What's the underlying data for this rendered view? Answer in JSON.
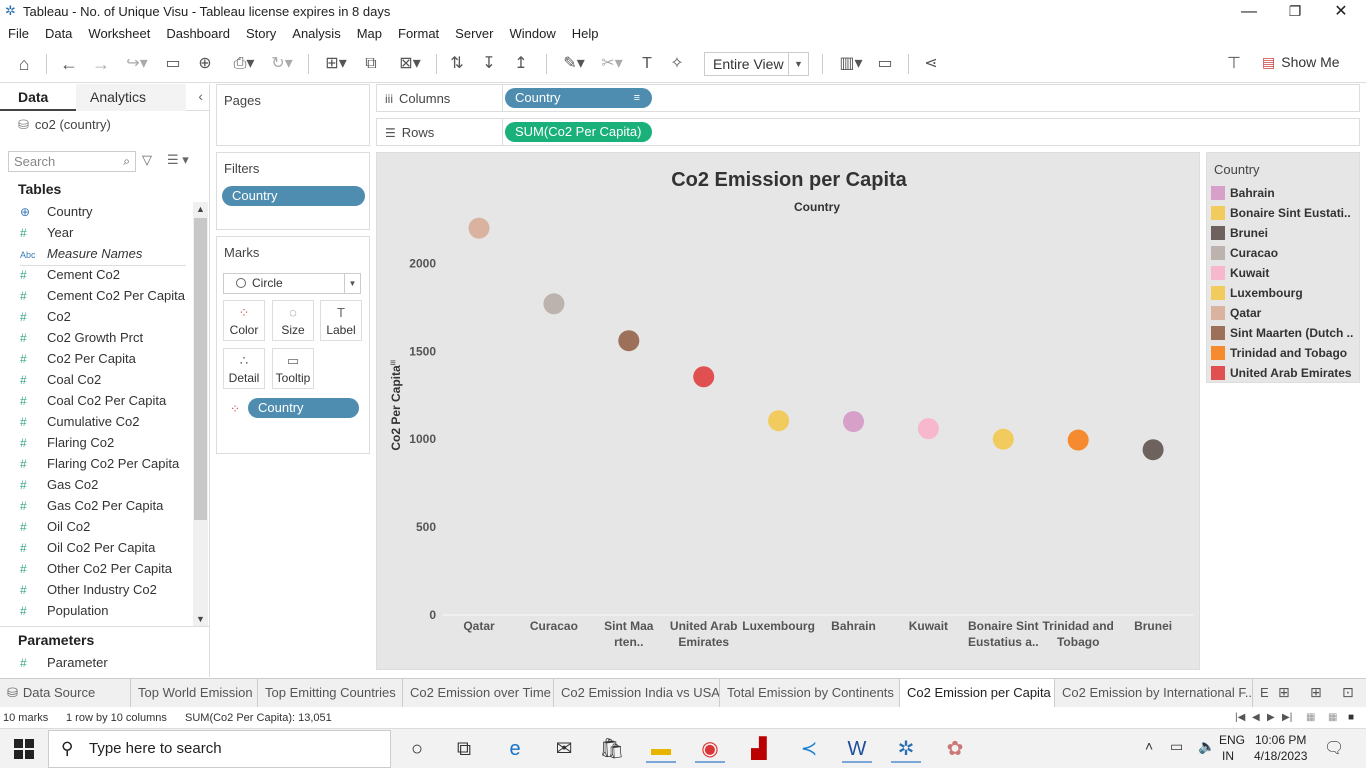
{
  "window": {
    "title": "Tableau - No. of Unique Visu - Tableau license expires in 8 days",
    "minimize": "—",
    "restore": "❐",
    "close": "✕"
  },
  "menu": [
    "File",
    "Data",
    "Worksheet",
    "Dashboard",
    "Story",
    "Analysis",
    "Map",
    "Format",
    "Server",
    "Window",
    "Help"
  ],
  "toolbar": {
    "fit_selector": "Entire View",
    "show_me": "Show Me"
  },
  "data_pane": {
    "tab_data": "Data",
    "tab_analytics": "Analytics",
    "datasource": "co2 (country)",
    "search_placeholder": "Search",
    "tables_header": "Tables",
    "fields": [
      {
        "type": "globe",
        "name": "Country"
      },
      {
        "type": "#",
        "name": "Year"
      },
      {
        "type": "Abc",
        "name": "Measure Names"
      },
      {
        "type": "#",
        "name": "Cement Co2"
      },
      {
        "type": "#",
        "name": "Cement Co2 Per Capita"
      },
      {
        "type": "#",
        "name": "Co2"
      },
      {
        "type": "#",
        "name": "Co2 Growth Prct"
      },
      {
        "type": "#",
        "name": "Co2 Per Capita"
      },
      {
        "type": "#",
        "name": "Coal Co2"
      },
      {
        "type": "#",
        "name": "Coal Co2 Per Capita"
      },
      {
        "type": "#",
        "name": "Cumulative Co2"
      },
      {
        "type": "#",
        "name": "Flaring Co2"
      },
      {
        "type": "#",
        "name": "Flaring Co2 Per Capita"
      },
      {
        "type": "#",
        "name": "Gas Co2"
      },
      {
        "type": "#",
        "name": "Gas Co2 Per Capita"
      },
      {
        "type": "#",
        "name": "Oil Co2"
      },
      {
        "type": "#",
        "name": "Oil Co2 Per Capita"
      },
      {
        "type": "#",
        "name": "Other Co2 Per Capita"
      },
      {
        "type": "#",
        "name": "Other Industry Co2"
      },
      {
        "type": "#",
        "name": "Population"
      }
    ],
    "parameters_header": "Parameters",
    "parameter": "Parameter"
  },
  "cards": {
    "pages": "Pages",
    "filters": "Filters",
    "filter_pill": "Country",
    "marks": "Marks",
    "mark_type": "Circle",
    "color": "Color",
    "size": "Size",
    "label": "Label",
    "detail": "Detail",
    "tooltip": "Tooltip",
    "marks_pill": "Country"
  },
  "shelves": {
    "columns_label": "Columns",
    "columns_pill": "Country",
    "rows_label": "Rows",
    "rows_pill": "SUM(Co2 Per Capita)"
  },
  "legend": {
    "title": "Country",
    "items": [
      {
        "name": "Bahrain",
        "color": "#d6a0c9"
      },
      {
        "name": "Bonaire Sint Eustati..",
        "color": "#f1cb5e"
      },
      {
        "name": "Brunei",
        "color": "#6e625f"
      },
      {
        "name": "Curacao",
        "color": "#bcb2ae"
      },
      {
        "name": "Kuwait",
        "color": "#f7b7cd"
      },
      {
        "name": "Luxembourg",
        "color": "#f1cb5e"
      },
      {
        "name": "Qatar",
        "color": "#d9b3a0"
      },
      {
        "name": "Sint Maarten (Dutch ..",
        "color": "#9c7059"
      },
      {
        "name": "Trinidad and Tobago",
        "color": "#f58b2e"
      },
      {
        "name": "United Arab Emirates",
        "color": "#e05050"
      }
    ]
  },
  "chart_data": {
    "type": "scatter",
    "title": "Co2 Emission per Capita",
    "xlabel": "Country",
    "ylabel": "Co2 Per Capita",
    "ylim": [
      0,
      2400
    ],
    "yticks": [
      0,
      500,
      1000,
      1500,
      2000
    ],
    "grid": false,
    "categories": [
      {
        "label": [
          "Qatar"
        ],
        "value": 2200,
        "color": "#d9b3a0"
      },
      {
        "label": [
          "Curacao"
        ],
        "value": 1770,
        "color": "#bcb2ae"
      },
      {
        "label": [
          "Sint Maa",
          "rten.."
        ],
        "value": 1560,
        "color": "#9c7059"
      },
      {
        "label": [
          "United Arab",
          "Emirates"
        ],
        "value": 1355,
        "color": "#e05050"
      },
      {
        "label": [
          "Luxembourg"
        ],
        "value": 1105,
        "color": "#f1cb5e"
      },
      {
        "label": [
          "Bahrain"
        ],
        "value": 1100,
        "color": "#d6a0c9"
      },
      {
        "label": [
          "Kuwait"
        ],
        "value": 1060,
        "color": "#f7b7cd"
      },
      {
        "label": [
          "Bonaire Sint",
          "Eustatius a.."
        ],
        "value": 1000,
        "color": "#f1cb5e"
      },
      {
        "label": [
          "Trinidad and",
          "Tobago"
        ],
        "value": 995,
        "color": "#f58b2e"
      },
      {
        "label": [
          "Brunei"
        ],
        "value": 940,
        "color": "#6e625f"
      }
    ]
  },
  "sheet_tabs": [
    {
      "label": "Data Source",
      "active": false
    },
    {
      "label": "Top World Emission",
      "active": false
    },
    {
      "label": "Top Emitting Countries",
      "active": false
    },
    {
      "label": "Co2 Emission over Time",
      "active": false
    },
    {
      "label": "Co2 Emission India vs USA",
      "active": false
    },
    {
      "label": "Total Emission by Continents",
      "active": false
    },
    {
      "label": "Co2 Emission per Capita",
      "active": true
    },
    {
      "label": "Co2 Emission by International F...",
      "active": false
    },
    {
      "label": "E",
      "active": false
    }
  ],
  "status": {
    "marks": "10 marks",
    "dims": "1 row by 10 columns",
    "sum": "SUM(Co2 Per Capita): 13,051"
  },
  "taskbar": {
    "search_placeholder": "Type here to search",
    "lang_top": "ENG",
    "lang_bottom": "IN",
    "time": "10:06 PM",
    "date": "4/18/2023"
  }
}
